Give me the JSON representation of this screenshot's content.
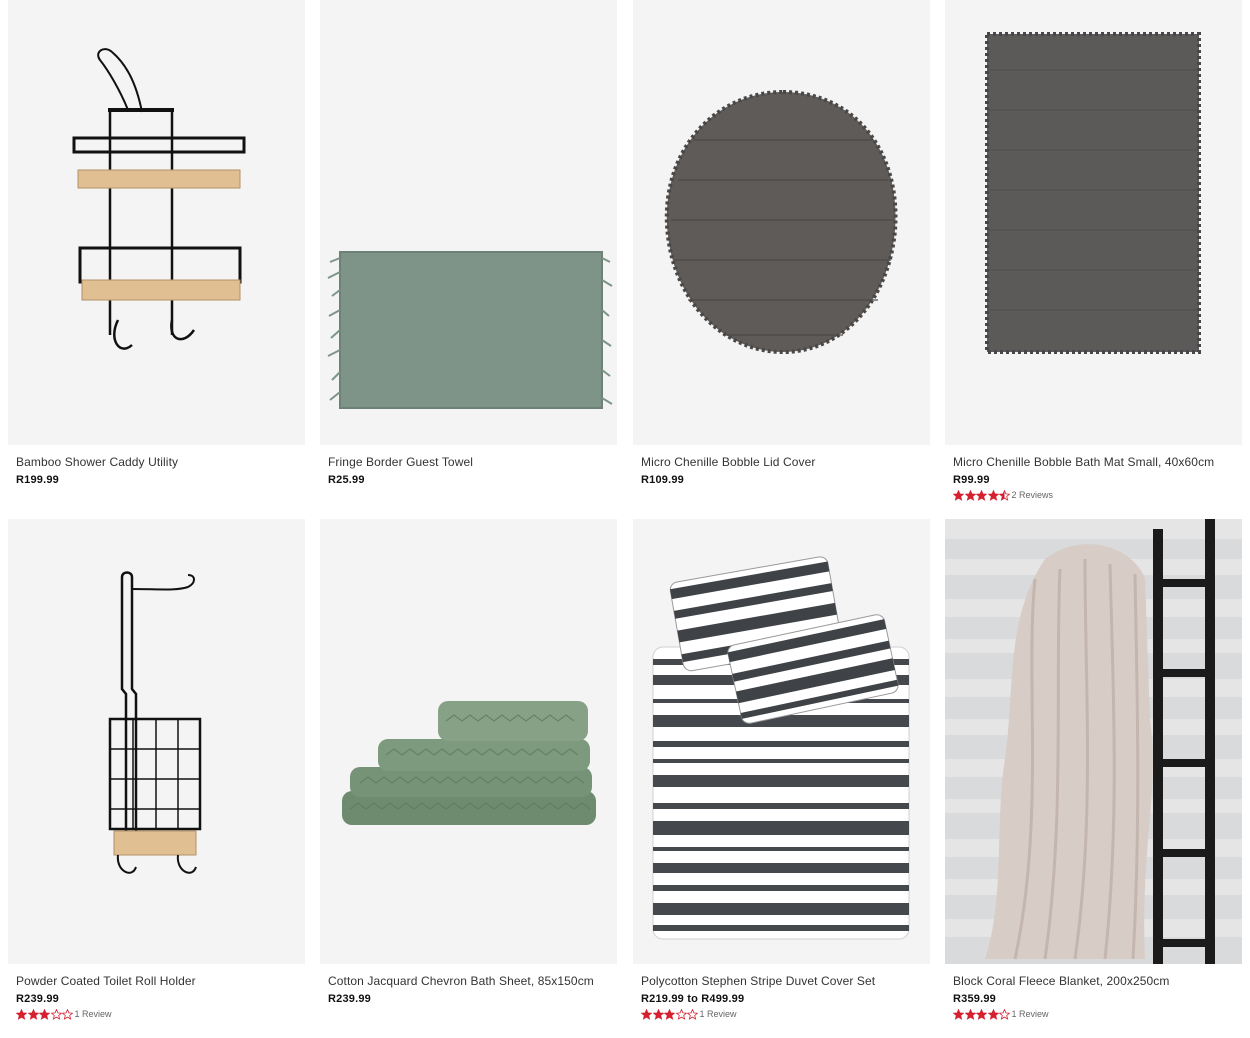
{
  "products": [
    {
      "title": "Bamboo Shower Caddy Utility",
      "price": "R199.99",
      "image": "shower-caddy-image"
    },
    {
      "title": "Fringe Border Guest Towel",
      "price": "R25.99",
      "image": "guest-towel-image"
    },
    {
      "title": "Micro Chenille Bobble Lid Cover",
      "price": "R109.99",
      "image": "lid-cover-image"
    },
    {
      "title": "Micro Chenille Bobble Bath Mat Small, 40x60cm",
      "price": "R99.99",
      "image": "bath-mat-image",
      "rating": 4.5,
      "reviews": "2 Reviews"
    },
    {
      "title": "Powder Coated Toilet Roll Holder",
      "price": "R239.99",
      "image": "toilet-roll-holder-image",
      "rating": 3,
      "reviews": "1 Review"
    },
    {
      "title": "Cotton Jacquard Chevron Bath Sheet, 85x150cm",
      "price": "R239.99",
      "image": "bath-sheet-stack-image"
    },
    {
      "title": "Polycotton Stephen Stripe Duvet Cover Set",
      "price": "R219.99 to R499.99",
      "image": "duvet-cover-image",
      "rating": 3,
      "reviews": "1 Review"
    },
    {
      "title": "Block Coral Fleece Blanket, 200x250cm",
      "price": "R359.99",
      "image": "fleece-blanket-image",
      "rating": 4,
      "reviews": "1 Review"
    }
  ],
  "colors": {
    "star": "#d6202f",
    "star_empty": "#d6202f",
    "image_bg": "#f4f4f4"
  }
}
